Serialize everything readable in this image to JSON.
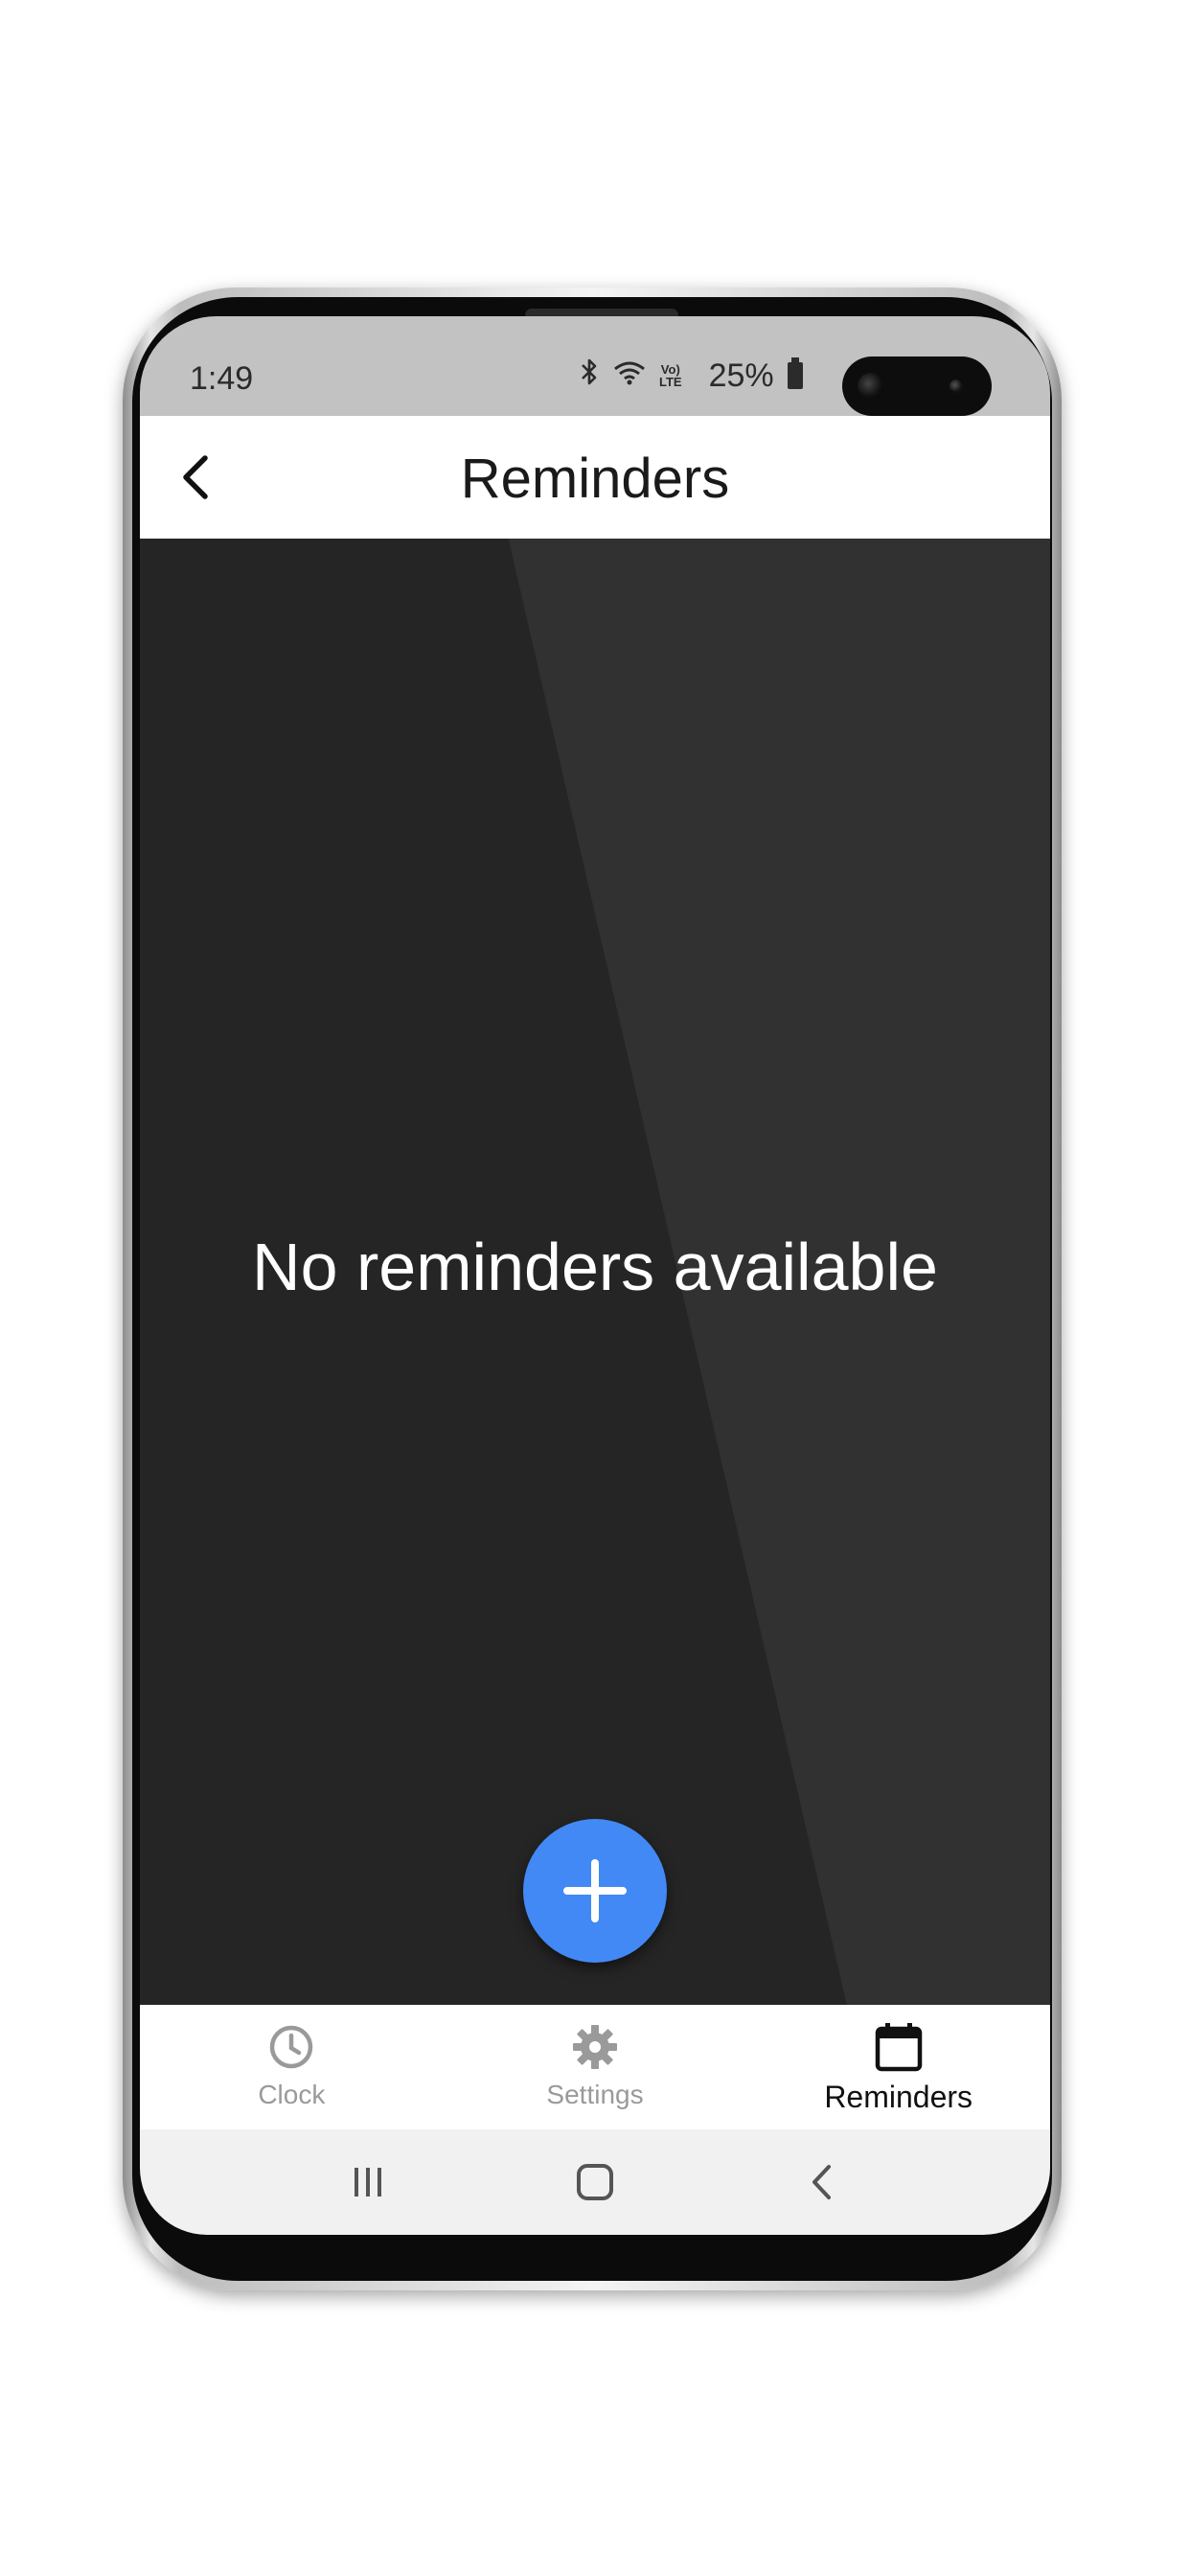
{
  "status_bar": {
    "time": "1:49",
    "battery_percent": "25%",
    "icons": [
      "bluetooth-icon",
      "wifi-icon",
      "volte-icon",
      "signal-icon",
      "battery-icon"
    ],
    "volte_top": "Vo)",
    "volte_bottom": "LTE"
  },
  "app_bar": {
    "title": "Reminders",
    "back_icon": "chevron-left-icon"
  },
  "content": {
    "empty_message": "No reminders available"
  },
  "fab": {
    "icon": "plus-icon",
    "color": "#4289f5"
  },
  "bottom_nav": {
    "items": [
      {
        "label": "Clock",
        "icon": "clock-icon",
        "active": false
      },
      {
        "label": "Settings",
        "icon": "gear-icon",
        "active": false
      },
      {
        "label": "Reminders",
        "icon": "calendar-icon",
        "active": true
      }
    ]
  },
  "system_nav": {
    "buttons": [
      "recents-icon",
      "home-icon",
      "back-icon"
    ]
  },
  "colors": {
    "content_background": "#252525",
    "status_bar": "#c2c2c2",
    "accent": "#4289f5",
    "inactive_nav": "#9a9a9a",
    "active_nav": "#111111"
  }
}
